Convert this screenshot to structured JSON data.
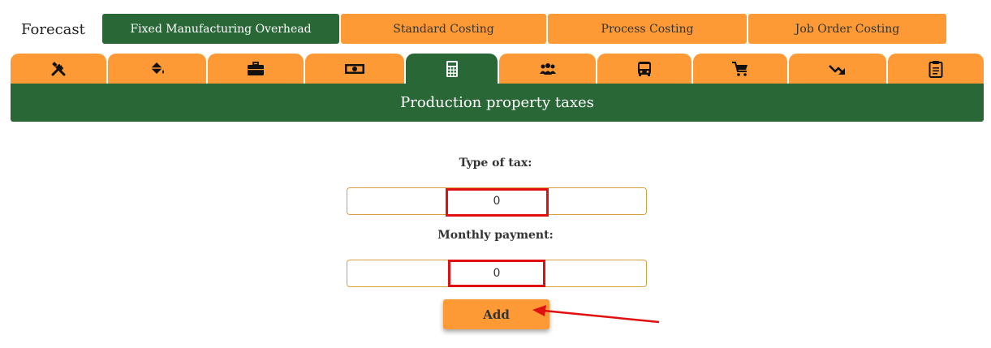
{
  "header": {
    "title": "Forecast",
    "tabs": [
      {
        "label": "Fixed Manufacturing Overhead",
        "active": true
      },
      {
        "label": "Standard Costing",
        "active": false
      },
      {
        "label": "Process Costing",
        "active": false
      },
      {
        "label": "Job Order Costing",
        "active": false
      }
    ]
  },
  "icon_tabs": [
    {
      "icon": "tools-icon",
      "active": false
    },
    {
      "icon": "paint-bucket-icon",
      "active": false
    },
    {
      "icon": "briefcase-icon",
      "active": false
    },
    {
      "icon": "money-icon",
      "active": false
    },
    {
      "icon": "calculator-icon",
      "active": true
    },
    {
      "icon": "users-icon",
      "active": false
    },
    {
      "icon": "bus-icon",
      "active": false
    },
    {
      "icon": "cart-icon",
      "active": false
    },
    {
      "icon": "trend-down-icon",
      "active": false
    },
    {
      "icon": "clipboard-icon",
      "active": false
    }
  ],
  "section": {
    "title": "Production property taxes"
  },
  "form": {
    "type_of_tax_label": "Type of tax:",
    "type_of_tax_value": "0",
    "monthly_payment_label": "Monthly payment:",
    "monthly_payment_value": "0",
    "add_label": "Add"
  },
  "colors": {
    "accent_orange": "#fd9a35",
    "brand_green": "#2a6737",
    "highlight_red": "#e01010"
  }
}
